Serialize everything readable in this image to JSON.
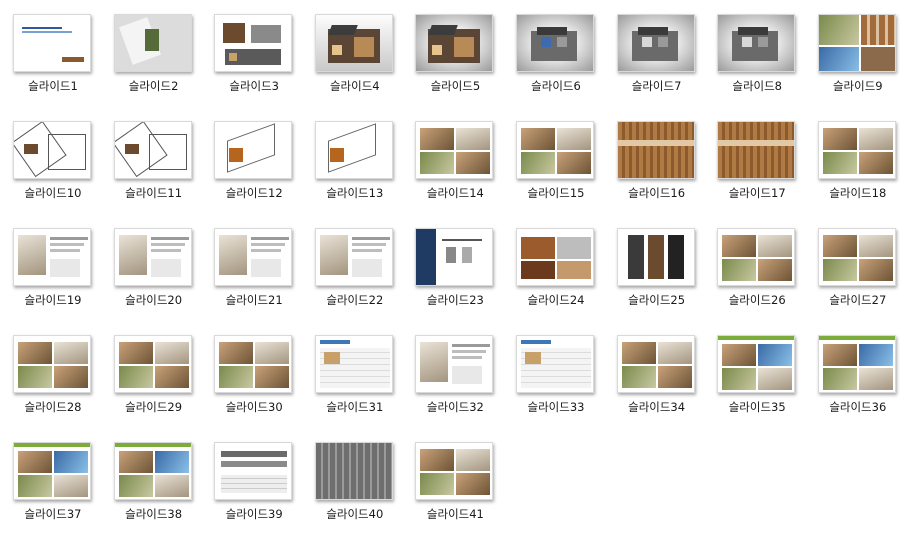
{
  "slides": [
    {
      "label": "슬라이드1",
      "kind": "title"
    },
    {
      "label": "슬라이드2",
      "kind": "site-plan"
    },
    {
      "label": "슬라이드3",
      "kind": "elevation"
    },
    {
      "label": "슬라이드4",
      "kind": "render-house"
    },
    {
      "label": "슬라이드5",
      "kind": "render-house-fade"
    },
    {
      "label": "슬라이드6",
      "kind": "render-dark"
    },
    {
      "label": "슬라이드7",
      "kind": "render-dark"
    },
    {
      "label": "슬라이드8",
      "kind": "render-dark"
    },
    {
      "label": "슬라이드9",
      "kind": "collage"
    },
    {
      "label": "슬라이드10",
      "kind": "floor-plan"
    },
    {
      "label": "슬라이드11",
      "kind": "floor-plan"
    },
    {
      "label": "슬라이드12",
      "kind": "iso-plan"
    },
    {
      "label": "슬라이드13",
      "kind": "iso-plan"
    },
    {
      "label": "슬라이드14",
      "kind": "photo-grid"
    },
    {
      "label": "슬라이드15",
      "kind": "photo-grid"
    },
    {
      "label": "슬라이드16",
      "kind": "wood-frame"
    },
    {
      "label": "슬라이드17",
      "kind": "wood-frame"
    },
    {
      "label": "슬라이드18",
      "kind": "photo-grid"
    },
    {
      "label": "슬라이드19",
      "kind": "product"
    },
    {
      "label": "슬라이드20",
      "kind": "product"
    },
    {
      "label": "슬라이드21",
      "kind": "product"
    },
    {
      "label": "슬라이드22",
      "kind": "product"
    },
    {
      "label": "슬라이드23",
      "kind": "navy-product"
    },
    {
      "label": "슬라이드24",
      "kind": "samples"
    },
    {
      "label": "슬라이드25",
      "kind": "doors"
    },
    {
      "label": "슬라이드26",
      "kind": "photo-grid"
    },
    {
      "label": "슬라이드27",
      "kind": "photo-grid"
    },
    {
      "label": "슬라이드28",
      "kind": "photo-grid"
    },
    {
      "label": "슬라이드29",
      "kind": "photo-grid"
    },
    {
      "label": "슬라이드30",
      "kind": "photo-grid"
    },
    {
      "label": "슬라이드31",
      "kind": "table"
    },
    {
      "label": "슬라이드32",
      "kind": "product"
    },
    {
      "label": "슬라이드33",
      "kind": "table"
    },
    {
      "label": "슬라이드34",
      "kind": "photo-grid"
    },
    {
      "label": "슬라이드35",
      "kind": "green-header"
    },
    {
      "label": "슬라이드36",
      "kind": "green-header"
    },
    {
      "label": "슬라이드37",
      "kind": "green-header"
    },
    {
      "label": "슬라이드38",
      "kind": "green-header"
    },
    {
      "label": "슬라이드39",
      "kind": "panels"
    },
    {
      "label": "슬라이드40",
      "kind": "cladding"
    },
    {
      "label": "슬라이드41",
      "kind": "photo-grid"
    }
  ]
}
